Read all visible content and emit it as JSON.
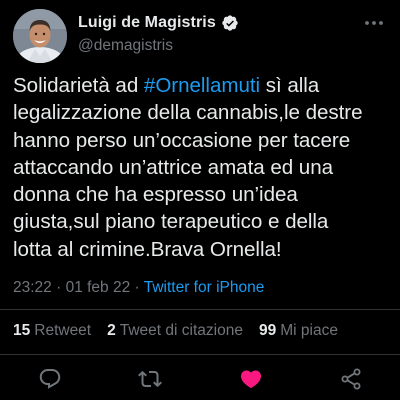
{
  "author": {
    "display_name": "Luigi de Magistris",
    "handle": "@demagistris",
    "verified": true,
    "avatar_icon": "profile-photo"
  },
  "tweet": {
    "text_before_hashtag": "Solidarietà ad ",
    "hashtag": "#Ornellamuti",
    "text_after_hashtag": " sì alla\nlegalizzazione della cannabis,le destre\nhanno perso un’occasione per tacere\nattaccando un’attrice amata ed una\ndonna che ha espresso un’idea\ngiusta,sul piano terapeutico e della\nlotta al crimine.Brava Ornella!",
    "time": "23:22",
    "separator": " · ",
    "date": "01 feb 22",
    "source": "Twitter for iPhone"
  },
  "stats": {
    "retweets_count": "15",
    "retweets_label": "Retweet",
    "quotes_count": "2",
    "quotes_label": "Tweet di citazione",
    "likes_count": "99",
    "likes_label": "Mi piace"
  },
  "actions": {
    "reply_icon": "reply-icon",
    "retweet_icon": "retweet-icon",
    "like_icon": "heart-icon",
    "share_icon": "share-icon",
    "liked": true
  },
  "colors": {
    "background": "#000000",
    "text": "#e7e9ea",
    "secondary": "#71767b",
    "accent": "#1d9bf0",
    "like": "#f91880",
    "divider": "#2f3336"
  }
}
